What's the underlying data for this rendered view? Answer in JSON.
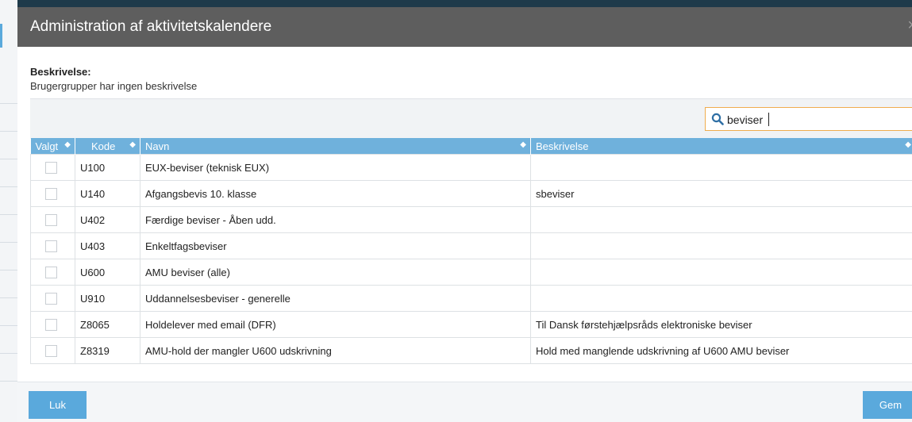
{
  "dialog": {
    "title": "Administration af aktivitetskalendere",
    "close_label": "×"
  },
  "description": {
    "label": "Beskrivelse:",
    "text": "Brugergrupper har ingen beskrivelse"
  },
  "search": {
    "value": "beviser",
    "icon": "search-icon"
  },
  "table": {
    "columns": [
      "Valgt",
      "Kode",
      "Navn",
      "Beskrivelse"
    ],
    "sort_glyph": "◆",
    "rows": [
      {
        "checked": false,
        "kode": "U100",
        "navn": "EUX-beviser (teknisk EUX)",
        "beskrivelse": ""
      },
      {
        "checked": false,
        "kode": "U140",
        "navn": "Afgangsbevis 10. klasse",
        "beskrivelse": "sbeviser"
      },
      {
        "checked": false,
        "kode": "U402",
        "navn": "Færdige beviser - Åben udd.",
        "beskrivelse": ""
      },
      {
        "checked": false,
        "kode": "U403",
        "navn": "Enkeltfagsbeviser",
        "beskrivelse": ""
      },
      {
        "checked": false,
        "kode": "U600",
        "navn": "AMU beviser (alle)",
        "beskrivelse": ""
      },
      {
        "checked": false,
        "kode": "U910",
        "navn": "Uddannelsesbeviser - generelle",
        "beskrivelse": ""
      },
      {
        "checked": false,
        "kode": "Z8065",
        "navn": "Holdelever med email (DFR)",
        "beskrivelse": "Til Dansk førstehjælpsråds elektroniske beviser"
      },
      {
        "checked": false,
        "kode": "Z8319",
        "navn": "AMU-hold der mangler U600 udskrivning",
        "beskrivelse": "Hold med manglende udskrivning af U600 AMU beviser"
      }
    ]
  },
  "footer": {
    "close_button": "Luk",
    "save_button": "Gem"
  },
  "colors": {
    "header_bg": "#5e5e5e",
    "table_header_bg": "#6fb1dc",
    "button_bg": "#5aa9dc",
    "search_border": "#f0ad4e"
  }
}
